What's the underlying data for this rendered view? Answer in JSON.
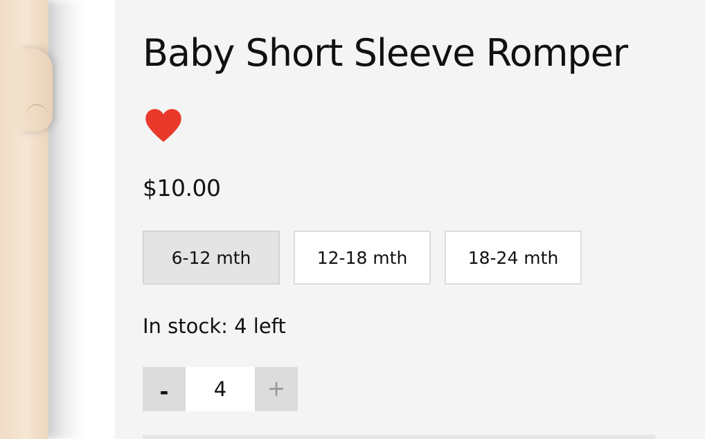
{
  "product": {
    "title": "Baby Short Sleeve Romper",
    "price": "$10.00",
    "favorite_icon": "heart-icon",
    "favorite_color": "#e8392b"
  },
  "sizes": [
    {
      "label": "6-12 mth",
      "selected": true
    },
    {
      "label": "12-18 mth",
      "selected": false
    },
    {
      "label": "18-24 mth",
      "selected": false
    }
  ],
  "stock": {
    "text": "In stock: 4 left"
  },
  "quantity": {
    "minus_label": "-",
    "value": "4",
    "plus_label": "+"
  },
  "colors": {
    "panel_background": "#f4f4f4",
    "selected_size_background": "#e4e4e4",
    "stepper_button_background": "#dcdcdc"
  }
}
